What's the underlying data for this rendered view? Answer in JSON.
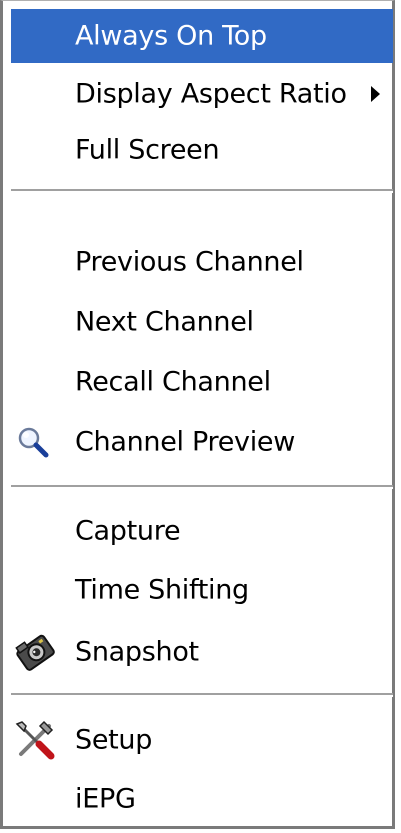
{
  "menu": {
    "items": [
      {
        "label": "Always On Top",
        "icon": "",
        "highlighted": true,
        "submenu": false
      },
      {
        "label": "Display Aspect Ratio",
        "icon": "",
        "highlighted": false,
        "submenu": true
      },
      {
        "label": "Full Screen",
        "icon": "",
        "highlighted": false,
        "submenu": false
      },
      {
        "label": "Previous Channel",
        "icon": "",
        "highlighted": false,
        "submenu": false
      },
      {
        "label": "Next Channel",
        "icon": "",
        "highlighted": false,
        "submenu": false
      },
      {
        "label": "Recall Channel",
        "icon": "",
        "highlighted": false,
        "submenu": false
      },
      {
        "label": "Channel Preview",
        "icon": "magnifier-icon",
        "highlighted": false,
        "submenu": false
      },
      {
        "label": "Capture",
        "icon": "",
        "highlighted": false,
        "submenu": false
      },
      {
        "label": "Time Shifting",
        "icon": "",
        "highlighted": false,
        "submenu": false
      },
      {
        "label": "Snapshot",
        "icon": "camera-icon",
        "highlighted": false,
        "submenu": false
      },
      {
        "label": "Setup",
        "icon": "tools-icon",
        "highlighted": false,
        "submenu": false
      },
      {
        "label": "iEPG",
        "icon": "",
        "highlighted": false,
        "submenu": false
      }
    ]
  },
  "colors": {
    "highlight_background": "#316ac5",
    "highlight_text": "#ffffff",
    "text": "#000000",
    "separator": "#a0a0a0"
  }
}
